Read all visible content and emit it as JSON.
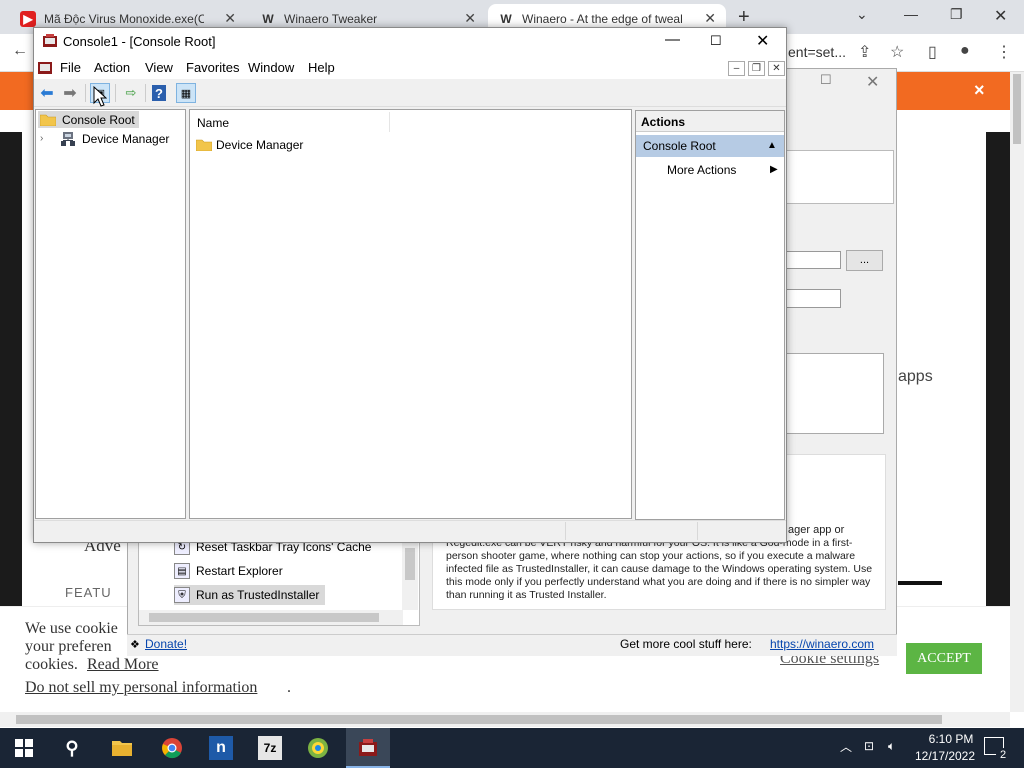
{
  "browser": {
    "tabs": [
      {
        "title": "Mã Độc Virus Monoxide.exe(CẦN",
        "favicon": "youtube-icon"
      },
      {
        "title": "Winaero Tweaker",
        "favicon": "winaero-icon"
      },
      {
        "title": "Winaero - At the edge of tweaki",
        "favicon": "winaero-icon"
      }
    ],
    "new_tab": "+",
    "url_tail": "ent=set...",
    "banner_close": "×"
  },
  "page": {
    "adve": "Adve",
    "featu": "FEATU",
    "apps": "apps",
    "cookie_text": "We use cookie your preferen cookies.",
    "cookie_text_lines": [
      "We use cookie",
      "your preferen",
      "cookies."
    ],
    "read_more": "Read More",
    "do_not_sell": "Do not sell my personal information",
    "dot": ".",
    "cookie_settings": "Cookie settings",
    "accept": "ACCEPT"
  },
  "tweaker": {
    "browse_label": "...",
    "tree_items": [
      "Reset Taskbar Tray Icons' Cache",
      "Restart Explorer",
      "Run as TrustedInstaller"
    ],
    "desc_upper": "ager app or",
    "description": "Regedit.exe can be VERY risky and harmful for your OS. It is like a God-mode in a first-person shooter game, where nothing can stop your actions, so if you execute a malware infected file as TrustedInstaller, it can cause damage to the Windows operating system. Use this mode only if you perfectly understand what you are doing and if there is no simpler way than running it as Trusted Installer.",
    "donate": "Donate!",
    "cool_stuff": "Get more cool stuff here:",
    "link": "https://winaero.com"
  },
  "mmc": {
    "title": "Console1 - [Console Root]",
    "menu": [
      "File",
      "Action",
      "View",
      "Favorites",
      "Window",
      "Help"
    ],
    "tree": {
      "root": "Console Root",
      "child": "Device Manager"
    },
    "list": {
      "header": "Name",
      "rows": [
        "Device Manager"
      ]
    },
    "actions": {
      "header": "Actions",
      "section": "Console Root",
      "more": "More Actions"
    }
  },
  "taskbar": {
    "time": "6:10 PM",
    "date": "12/17/2022",
    "notification_count": "2"
  },
  "colors": {
    "orange_banner": "#f26a21",
    "accept_green": "#5cb544",
    "actions_section": "#b6cbe4",
    "taskbar": "#1a2535"
  }
}
